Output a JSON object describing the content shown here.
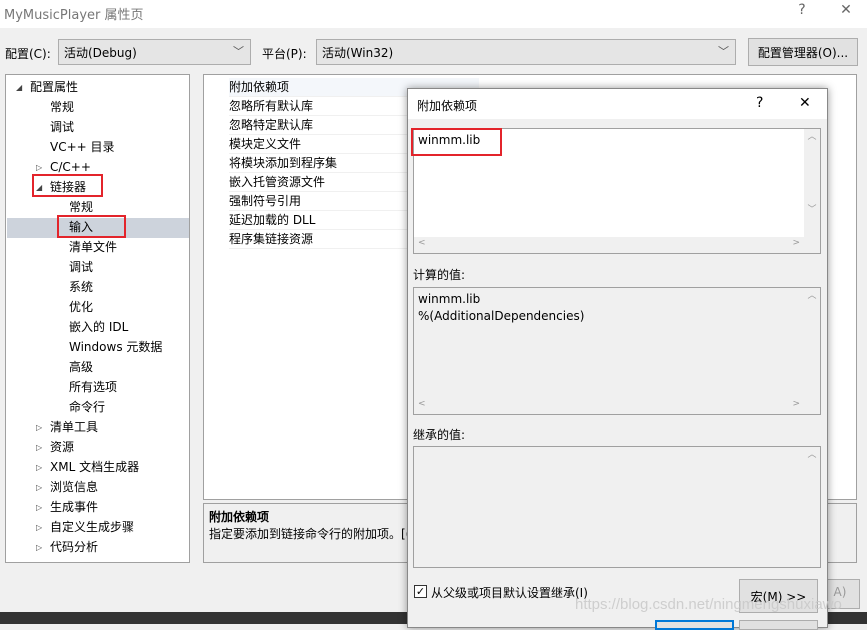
{
  "window": {
    "title": "MyMusicPlayer 属性页",
    "help": "?",
    "close": "✕"
  },
  "toolbar": {
    "config_label": "配置(C):",
    "config_value": "活动(Debug)",
    "platform_label": "平台(P):",
    "platform_value": "活动(Win32)",
    "config_manager": "配置管理器(O)..."
  },
  "tree": {
    "items": [
      {
        "label": "配置属性",
        "level": 0,
        "expanded": true
      },
      {
        "label": "常规",
        "level": 1
      },
      {
        "label": "调试",
        "level": 1
      },
      {
        "label": "VC++ 目录",
        "level": 1
      },
      {
        "label": "C/C++",
        "level": 1,
        "collapsed": true
      },
      {
        "label": "链接器",
        "level": 1,
        "expanded": true
      },
      {
        "label": "常规",
        "level": 2
      },
      {
        "label": "输入",
        "level": 2,
        "selected": true
      },
      {
        "label": "清单文件",
        "level": 2
      },
      {
        "label": "调试",
        "level": 2
      },
      {
        "label": "系统",
        "level": 2
      },
      {
        "label": "优化",
        "level": 2
      },
      {
        "label": "嵌入的 IDL",
        "level": 2
      },
      {
        "label": "Windows 元数据",
        "level": 2
      },
      {
        "label": "高级",
        "level": 2
      },
      {
        "label": "所有选项",
        "level": 2
      },
      {
        "label": "命令行",
        "level": 2
      },
      {
        "label": "清单工具",
        "level": 1,
        "collapsed": true
      },
      {
        "label": "资源",
        "level": 1,
        "collapsed": true
      },
      {
        "label": "XML 文档生成器",
        "level": 1,
        "collapsed": true
      },
      {
        "label": "浏览信息",
        "level": 1,
        "collapsed": true
      },
      {
        "label": "生成事件",
        "level": 1,
        "collapsed": true
      },
      {
        "label": "自定义生成步骤",
        "level": 1,
        "collapsed": true
      },
      {
        "label": "代码分析",
        "level": 1,
        "collapsed": true
      }
    ]
  },
  "grid": {
    "items": [
      "附加依赖项",
      "忽略所有默认库",
      "忽略特定默认库",
      "模块定义文件",
      "将模块添加到程序集",
      "嵌入托管资源文件",
      "强制符号引用",
      "延迟加载的 DLL",
      "程序集链接资源"
    ]
  },
  "description": {
    "title": "附加依赖项",
    "text": "指定要添加到链接命令行的附加项。[("
  },
  "dialog": {
    "title": "附加依赖项",
    "help": "?",
    "close": "✕",
    "input_value": "winmm.lib",
    "computed_label": "计算的值:",
    "computed_lines": [
      "winmm.lib",
      "%(AdditionalDependencies)"
    ],
    "inherited_label": "继承的值:",
    "inherit_checkbox": "从父级或项目默认设置继承(I)",
    "inherit_checked": true,
    "macro_button": "宏(M) >>"
  },
  "behind_button_fragment": "A)",
  "watermark": "https://blog.csdn.net/ningmengshuxiawo",
  "colors": {
    "highlight": "#e3242b",
    "selected_row": "#cdd3dc"
  }
}
